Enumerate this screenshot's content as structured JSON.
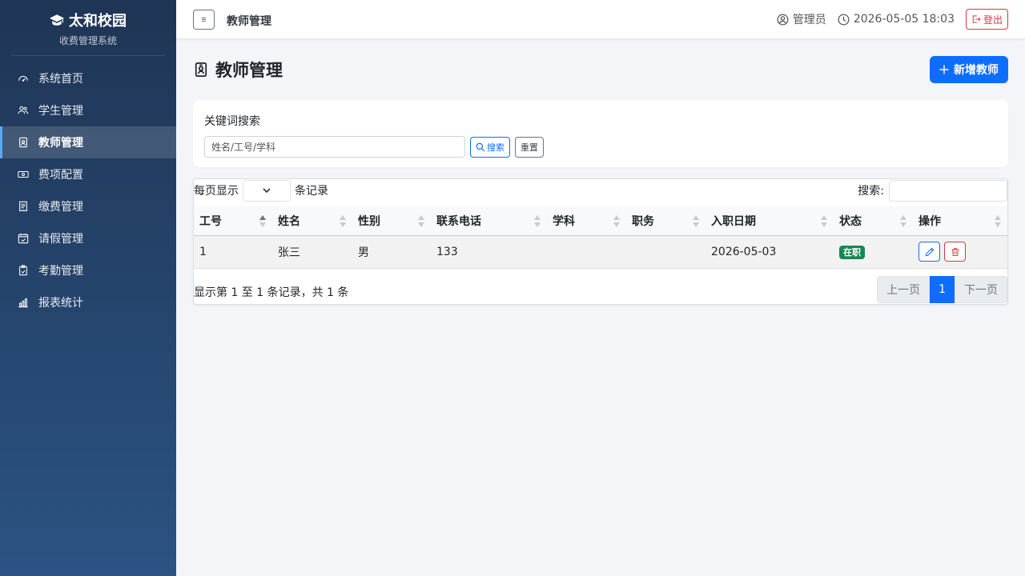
{
  "brand": {
    "title": "太和校园",
    "subtitle": "收费管理系统"
  },
  "sidebar": {
    "items": [
      {
        "label": "系统首页",
        "icon": "speedometer-icon"
      },
      {
        "label": "学生管理",
        "icon": "people-icon"
      },
      {
        "label": "教师管理",
        "icon": "person-badge-icon",
        "active": true
      },
      {
        "label": "费项配置",
        "icon": "cash-icon"
      },
      {
        "label": "缴费管理",
        "icon": "receipt-icon"
      },
      {
        "label": "请假管理",
        "icon": "calendar-check-icon"
      },
      {
        "label": "考勤管理",
        "icon": "clipboard-check-icon"
      },
      {
        "label": "报表统计",
        "icon": "bar-chart-icon"
      }
    ]
  },
  "topbar": {
    "title": "教师管理",
    "user": "管理员",
    "datetime": "2026-05-05 18:03",
    "logout_label": "登出"
  },
  "page": {
    "title": "教师管理",
    "add_button_label": "新增教师"
  },
  "search": {
    "label": "关键词搜索",
    "placeholder": "姓名/工号/学科",
    "search_button_label": "搜索",
    "reset_button_label": "重置"
  },
  "table": {
    "length_prefix": "每页显示",
    "length_suffix": "条记录",
    "filter_label": "搜索:",
    "columns": [
      "工号",
      "姓名",
      "性别",
      "联系电话",
      "学科",
      "职务",
      "入职日期",
      "状态",
      "操作"
    ],
    "rows": [
      {
        "id": "1",
        "name": "张三",
        "gender": "男",
        "phone": "133",
        "subject": "",
        "position": "",
        "hire_date": "2026-05-03",
        "status": "在职"
      }
    ],
    "info": "显示第 1 至 1 条记录，共 1 条",
    "pager": {
      "prev": "上一页",
      "current": "1",
      "next": "下一页"
    }
  },
  "colors": {
    "primary": "#0d6efd",
    "danger": "#dc3545",
    "success": "#198754",
    "sidebar_top": "#1f3555",
    "sidebar_bottom": "#2b5383"
  }
}
